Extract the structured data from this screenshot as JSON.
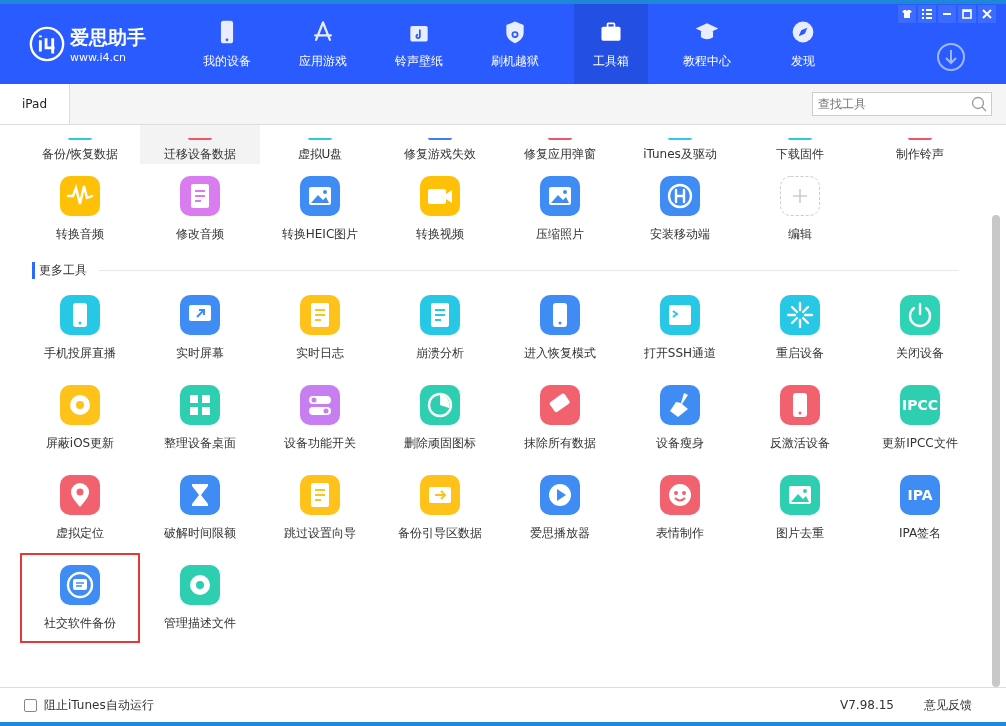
{
  "app": {
    "name": "爱思助手",
    "url": "www.i4.cn"
  },
  "nav": [
    {
      "label": "我的设备",
      "selected": false
    },
    {
      "label": "应用游戏",
      "selected": false
    },
    {
      "label": "铃声壁纸",
      "selected": false
    },
    {
      "label": "刷机越狱",
      "selected": false
    },
    {
      "label": "工具箱",
      "selected": true
    },
    {
      "label": "教程中心",
      "selected": false
    },
    {
      "label": "发现",
      "selected": false
    }
  ],
  "device_tabs": [
    {
      "label": "iPad",
      "selected": true
    }
  ],
  "search": {
    "placeholder": "查找工具"
  },
  "top_tools": [
    {
      "label": "备份/恢复数据",
      "color": "#2ccbe0",
      "selected": false
    },
    {
      "label": "迁移设备数据",
      "color": "#f0566a",
      "selected": true
    },
    {
      "label": "虚拟U盘",
      "color": "#2ccbe0",
      "selected": false
    },
    {
      "label": "修复游戏失效",
      "color": "#3d7ef2",
      "selected": false
    },
    {
      "label": "修复应用弹窗",
      "color": "#f0566a",
      "selected": false
    },
    {
      "label": "iTunes及驱动",
      "color": "#2ccbe0",
      "selected": false
    },
    {
      "label": "下载固件",
      "color": "#2ccbe0",
      "selected": false
    },
    {
      "label": "制作铃声",
      "color": "#f0566a",
      "selected": false
    }
  ],
  "tools": [
    {
      "kind": "tool",
      "label": "转换音频",
      "color": "#ffc107"
    },
    {
      "kind": "tool",
      "label": "修改音频",
      "color": "#d97cf0"
    },
    {
      "kind": "tool",
      "label": "转换HEIC图片",
      "color": "#3f8cf5"
    },
    {
      "kind": "tool",
      "label": "转换视频",
      "color": "#ffc107"
    },
    {
      "kind": "tool",
      "label": "压缩照片",
      "color": "#3f8cf5"
    },
    {
      "kind": "tool",
      "label": "安装移动端",
      "color": "#3f8cf5"
    },
    {
      "kind": "add",
      "label": "编辑"
    }
  ],
  "more_tools": {
    "title": "更多工具",
    "items": [
      {
        "label": "手机投屏直播",
        "color": "#27c8e6",
        "outlined": false
      },
      {
        "label": "实时屏幕",
        "color": "#3f8cf5",
        "outlined": false
      },
      {
        "label": "实时日志",
        "color": "#ffc21a",
        "outlined": false
      },
      {
        "label": "崩溃分析",
        "color": "#27c8e6",
        "outlined": false
      },
      {
        "label": "进入恢复模式",
        "color": "#3f8cf5",
        "outlined": false
      },
      {
        "label": "打开SSH通道",
        "color": "#27c8e6",
        "outlined": false
      },
      {
        "label": "重启设备",
        "color": "#27c8e6",
        "outlined": false
      },
      {
        "label": "关闭设备",
        "color": "#2dd3b4",
        "outlined": false
      },
      {
        "label": "屏蔽iOS更新",
        "color": "#ffc21a",
        "outlined": false
      },
      {
        "label": "整理设备桌面",
        "color": "#2dcfb0",
        "outlined": false
      },
      {
        "label": "设备功能开关",
        "color": "#c77ef0",
        "outlined": false
      },
      {
        "label": "删除顽固图标",
        "color": "#2dcfb0",
        "outlined": false
      },
      {
        "label": "抹除所有数据",
        "color": "#f2616e",
        "outlined": false
      },
      {
        "label": "设备瘦身",
        "color": "#3f8cf5",
        "outlined": false
      },
      {
        "label": "反激活设备",
        "color": "#f2616e",
        "outlined": false
      },
      {
        "label": "更新IPCC文件",
        "color": "#2dcfb0",
        "outlined": false,
        "icon_text": "IPCC"
      },
      {
        "label": "虚拟定位",
        "color": "#f2616e",
        "outlined": false
      },
      {
        "label": "破解时间限额",
        "color": "#3f8cf5",
        "outlined": false
      },
      {
        "label": "跳过设置向导",
        "color": "#ffc21a",
        "outlined": false
      },
      {
        "label": "备份引导区数据",
        "color": "#ffc21a",
        "outlined": false
      },
      {
        "label": "爱思播放器",
        "color": "#3f8cf5",
        "outlined": false
      },
      {
        "label": "表情制作",
        "color": "#f2616e",
        "outlined": false
      },
      {
        "label": "图片去重",
        "color": "#2dcfb0",
        "outlined": false
      },
      {
        "label": "IPA签名",
        "color": "#3f8cf5",
        "outlined": false,
        "icon_text": "IPA"
      },
      {
        "label": "社交软件备份",
        "color": "#3f8cf5",
        "outlined": true
      },
      {
        "label": "管理描述文件",
        "color": "#2dcfb0",
        "outlined": false
      }
    ]
  },
  "status_bar": {
    "checkbox": {
      "label": "阻止iTunes自动运行",
      "checked": false
    },
    "version": "V7.98.15",
    "feedback": "意见反馈"
  }
}
